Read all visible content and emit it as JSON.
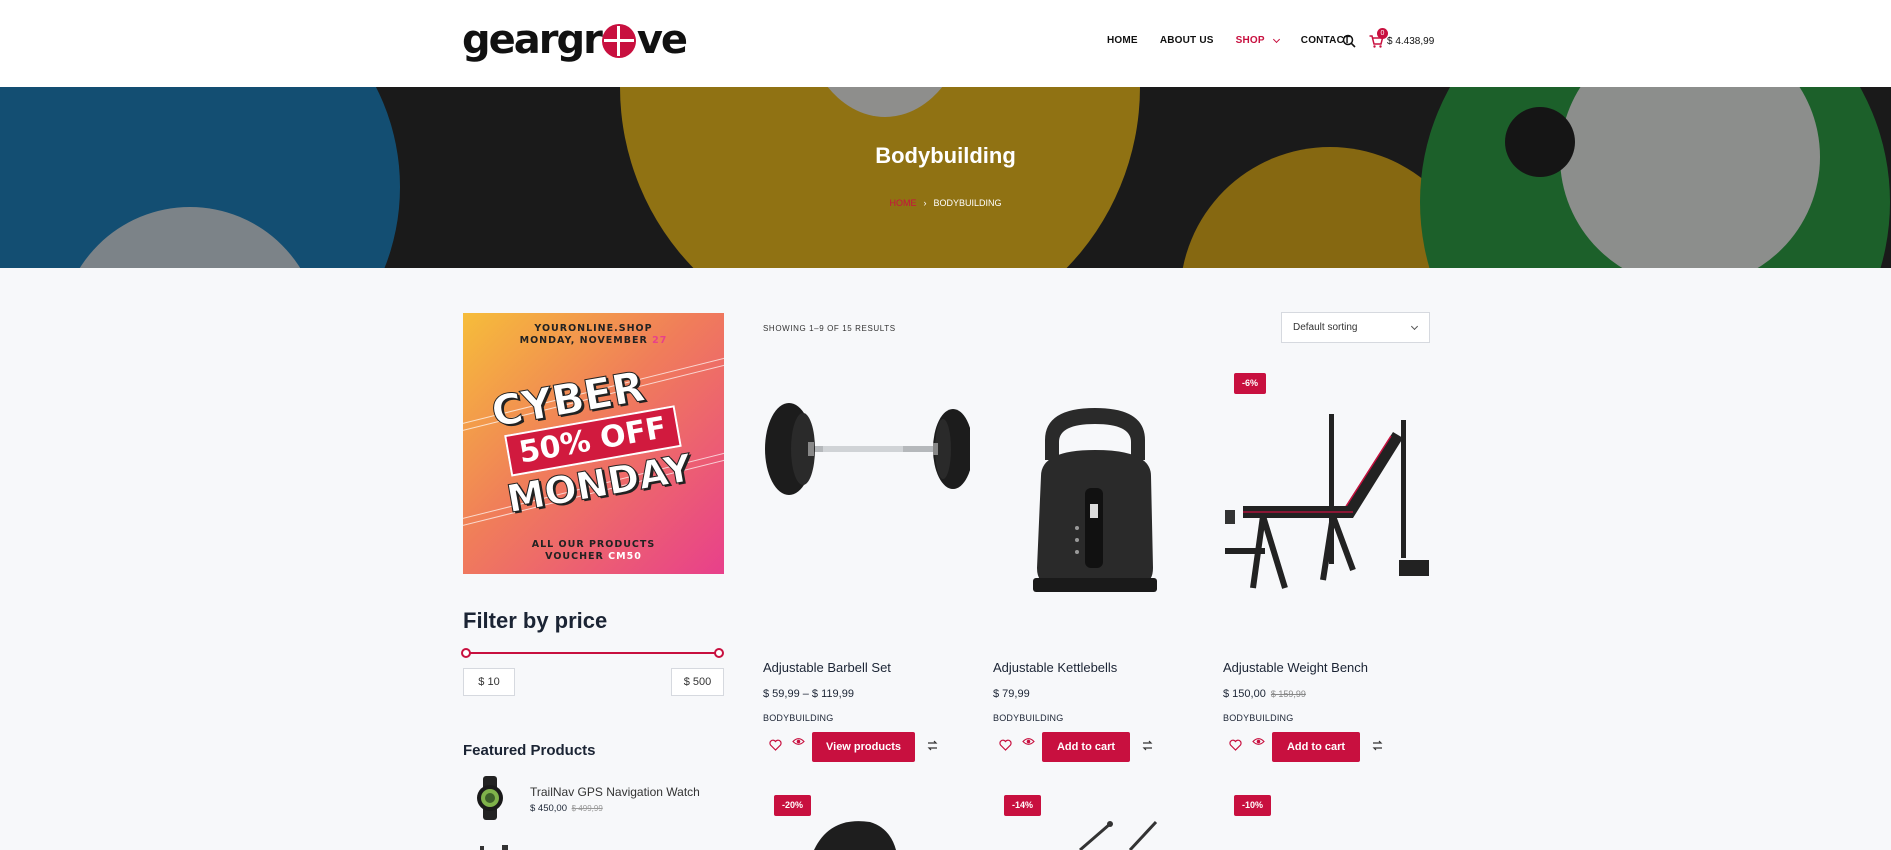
{
  "brand": {
    "logo_left": "geargr",
    "logo_right": "ve"
  },
  "nav": {
    "items": [
      {
        "label": "HOME"
      },
      {
        "label": "ABOUT US"
      },
      {
        "label": "SHOP"
      },
      {
        "label": "CONTACT"
      }
    ],
    "cart_count": "0",
    "cart_total": "$ 4.438,99"
  },
  "hero": {
    "title": "Bodybuilding",
    "breadcrumb": {
      "home": "HOME",
      "separator": "›",
      "current": "BODYBUILDING"
    }
  },
  "promo": {
    "site": "YOURONLINE.SHOP",
    "date_prefix": "MONDAY, NOVEMBER",
    "date_day": "27",
    "headline_top": "CYBER",
    "discount": "50% OFF",
    "headline_bottom": "MONDAY",
    "footer_line1": "ALL OUR PRODUCTS",
    "footer_prefix": "VOUCHER",
    "footer_code": "CM50"
  },
  "filter": {
    "title": "Filter by price",
    "min": "$ 10",
    "max": "$ 500"
  },
  "featured": {
    "title": "Featured Products",
    "items": [
      {
        "name": "TrailNav GPS Navigation Watch",
        "price": "$ 450,00",
        "old_price": "$ 499,99"
      }
    ]
  },
  "shop": {
    "result_count": "SHOWING 1–9 OF 15 RESULTS",
    "sort_label": "Default sorting",
    "products": [
      {
        "name": "Adjustable Barbell Set",
        "price": "$ 59,99 – $ 119,99",
        "old_price": "",
        "category": "BODYBUILDING",
        "button": "View products",
        "badge": ""
      },
      {
        "name": "Adjustable Kettlebells",
        "price": "$ 79,99",
        "old_price": "",
        "category": "BODYBUILDING",
        "button": "Add to cart",
        "badge": ""
      },
      {
        "name": "Adjustable Weight Bench",
        "price": "$ 150,00",
        "old_price": "$ 159,99",
        "category": "BODYBUILDING",
        "button": "Add to cart",
        "badge": "-6%"
      }
    ],
    "row2_badges": [
      "-20%",
      "-14%",
      "-10%"
    ]
  },
  "colors": {
    "accent": "#c8103f",
    "text": "#1b2434",
    "background": "#f7f8fa"
  }
}
